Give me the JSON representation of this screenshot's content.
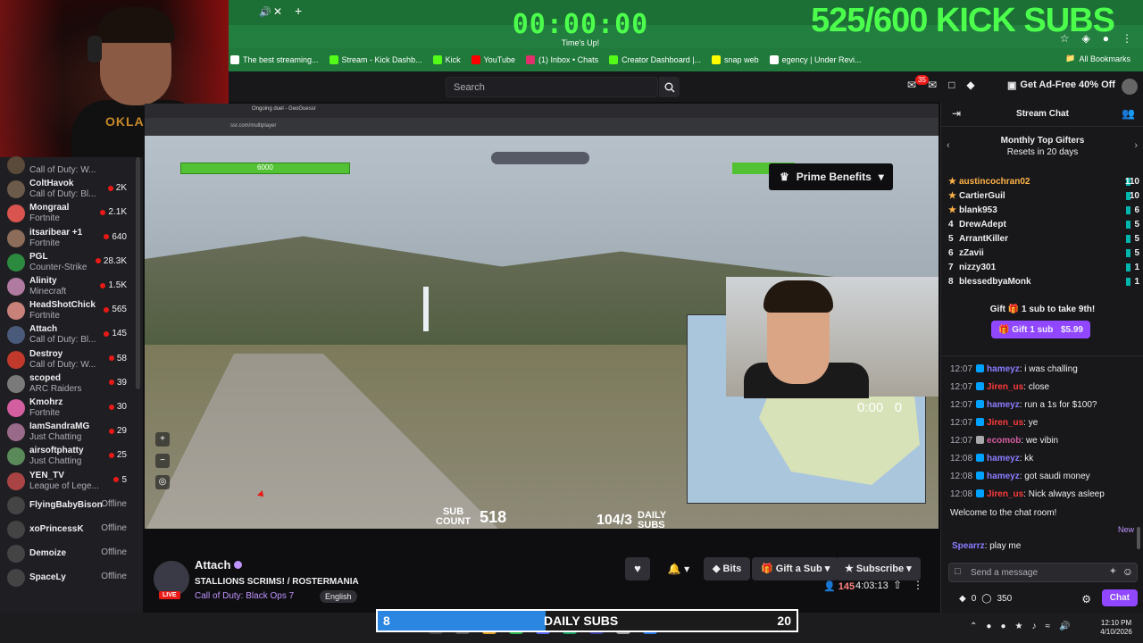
{
  "overlay": {
    "timer": "00:00:00",
    "timer_caption": "Time's Up!",
    "sub_goal": "525/600 KICK SUBS"
  },
  "bookmarks": {
    "items": [
      {
        "label": "The best streaming...",
        "color": "#ffffff"
      },
      {
        "label": "Stream - Kick Dashb...",
        "color": "#53fc18"
      },
      {
        "label": "Kick",
        "color": "#53fc18"
      },
      {
        "label": "YouTube",
        "color": "#ff0000"
      },
      {
        "label": "(1) Inbox • Chats",
        "color": "#e1306c"
      },
      {
        "label": "Creator Dashboard |...",
        "color": "#53fc18"
      },
      {
        "label": "snap web",
        "color": "#fffc00"
      },
      {
        "label": "egency | Under Revi...",
        "color": "#ffffff"
      }
    ],
    "all_label": "All Bookmarks"
  },
  "topbar": {
    "search_placeholder": "Search",
    "notif_count": "35",
    "adfree_label": "Get Ad-Free 40% Off"
  },
  "sidebar": {
    "channels": [
      {
        "name": "",
        "game": "Call of Duty: W...",
        "count": "",
        "color": "#5a4a3a",
        "live": true
      },
      {
        "name": "ColtHavok",
        "game": "Call of Duty: Bl...",
        "count": "2K",
        "color": "#6c5b4b",
        "live": true
      },
      {
        "name": "Mongraal",
        "game": "Fortnite",
        "count": "2.1K",
        "color": "#d9534f",
        "live": true
      },
      {
        "name": "itsaribear +1",
        "game": "Fortnite",
        "count": "640",
        "color": "#8e6c5a",
        "live": true
      },
      {
        "name": "PGL",
        "game": "Counter-Strike",
        "count": "28.3K",
        "color": "#2b8a3e",
        "live": true
      },
      {
        "name": "Alinity",
        "game": "Minecraft",
        "count": "1.5K",
        "color": "#b07aa1",
        "live": true
      },
      {
        "name": "HeadShotChick",
        "game": "Fortnite",
        "count": "565",
        "color": "#c9827a",
        "live": true
      },
      {
        "name": "Attach",
        "game": "Call of Duty: Bl...",
        "count": "145",
        "color": "#4a5a7a",
        "live": true
      },
      {
        "name": "Destroy",
        "game": "Call of Duty: W...",
        "count": "58",
        "color": "#c0392b",
        "live": true
      },
      {
        "name": "scoped",
        "game": "ARC Raiders",
        "count": "39",
        "color": "#7a7a7a",
        "live": true
      },
      {
        "name": "Kmohrz",
        "game": "Fortnite",
        "count": "30",
        "color": "#d35ea0",
        "live": true
      },
      {
        "name": "IamSandraMG",
        "game": "Just Chatting",
        "count": "29",
        "color": "#9a6a8a",
        "live": true
      },
      {
        "name": "airsoftphatty",
        "game": "Just Chatting",
        "count": "25",
        "color": "#5a8a5a",
        "live": true
      },
      {
        "name": "YEN_TV",
        "game": "League of Lege...",
        "count": "5",
        "color": "#aa4444",
        "live": true
      },
      {
        "name": "FlyingBabyBison",
        "game": "",
        "count": "Offline",
        "color": "#444",
        "live": false
      },
      {
        "name": "xoPrincessK",
        "game": "",
        "count": "Offline",
        "color": "#444",
        "live": false
      },
      {
        "name": "Demoize",
        "game": "",
        "count": "Offline",
        "color": "#444",
        "live": false
      },
      {
        "name": "SpaceLy",
        "game": "",
        "count": "Offline",
        "color": "#444",
        "live": false
      }
    ]
  },
  "video": {
    "prime_label": "Prime Benefits",
    "hp_value": "6000",
    "guest_score": "0:00",
    "guest_score_right": "0",
    "sub_count_label_1": "SUB",
    "sub_count_label_2": "COUNT",
    "sub_count_value": "518",
    "daily_value": "104/3",
    "daily_label_1": "DAILY",
    "daily_label_2": "SUBS"
  },
  "channel": {
    "name": "Attach",
    "live_label": "LIVE",
    "title": "STALLIONS SCRIMS! / ROSTERMANIA",
    "game": "Call of Duty: Black Ops 7",
    "language": "English",
    "bits_label": "Bits",
    "gift_label": "Gift a Sub",
    "subscribe_label": "Subscribe",
    "viewers": "145",
    "uptime": "4:03:13"
  },
  "chat": {
    "title": "Stream Chat",
    "gifters_title": "Monthly Top Gifters",
    "gifters_subtitle": "Resets in 20 days",
    "gifters": [
      {
        "rank": "",
        "name": "austincochran02",
        "count": "110",
        "color": "#ffb347"
      },
      {
        "rank": "",
        "name": "CartierGuil",
        "count": "10",
        "color": "#efeff1"
      },
      {
        "rank": "",
        "name": "blank953",
        "count": "6",
        "color": "#efeff1"
      },
      {
        "rank": "4",
        "name": "DrewAdept",
        "count": "5",
        "color": "#efeff1"
      },
      {
        "rank": "5",
        "name": "ArrantKiller",
        "count": "5",
        "color": "#efeff1"
      },
      {
        "rank": "6",
        "name": "zZavii",
        "count": "5",
        "color": "#efeff1"
      },
      {
        "rank": "7",
        "name": "nizzy301",
        "count": "1",
        "color": "#efeff1"
      },
      {
        "rank": "8",
        "name": "blessedbyaMonk",
        "count": "1",
        "color": "#efeff1"
      }
    ],
    "gift_prompt": "Gift 🎁 1 sub to take 9th!",
    "gift_button": "Gift 1 sub",
    "gift_price": "$5.99",
    "messages": [
      {
        "time": "12:07",
        "user": "hameyz",
        "text": "i was challing",
        "color": "#8a7dff",
        "badge": "#00a2ff"
      },
      {
        "time": "12:07",
        "user": "Jiren_us",
        "text": "close",
        "color": "#ff3b3b",
        "badge": "#00a2ff"
      },
      {
        "time": "12:07",
        "user": "hameyz",
        "text": "run a 1s for $100?",
        "color": "#8a7dff",
        "badge": "#00a2ff"
      },
      {
        "time": "12:07",
        "user": "Jiren_us",
        "text": "ye",
        "color": "#ff3b3b",
        "badge": "#00a2ff"
      },
      {
        "time": "12:07",
        "user": "ecomob",
        "text": "we vibin",
        "color": "#d35ea0",
        "badge": "#aaaaaa"
      },
      {
        "time": "12:08",
        "user": "hameyz",
        "text": "kk",
        "color": "#8a7dff",
        "badge": "#00a2ff"
      },
      {
        "time": "12:08",
        "user": "hameyz",
        "text": "got saudi money",
        "color": "#8a7dff",
        "badge": "#00a2ff"
      },
      {
        "time": "12:08",
        "user": "Jiren_us",
        "text": "Nick always asleep",
        "color": "#ff3b3b",
        "badge": "#00a2ff"
      }
    ],
    "welcome": "Welcome to the chat room!",
    "new_label": "New",
    "last_user": "Spearrz",
    "last_text": "play me",
    "input_placeholder": "Send a message",
    "points_a": "0",
    "points_b": "350",
    "send_label": "Chat"
  },
  "daily_bar": {
    "left": "8",
    "label": "DAILY SUBS",
    "right": "20",
    "progress": 0.4
  },
  "taskbar": {
    "time": "12:10 PM",
    "date": "4/10/2026"
  }
}
